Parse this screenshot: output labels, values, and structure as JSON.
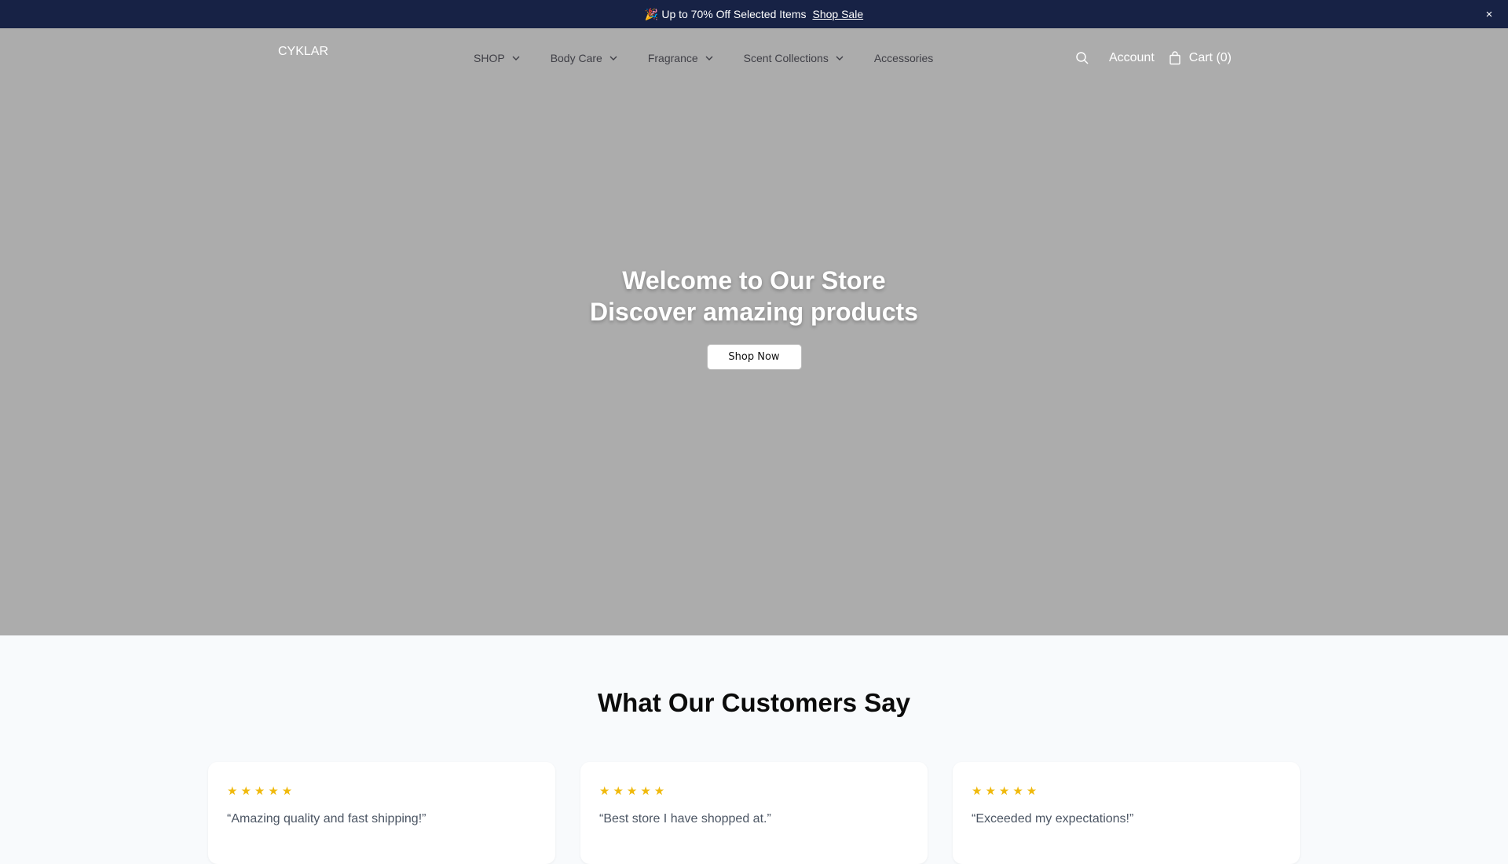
{
  "announcement": {
    "emoji": "🎉",
    "text": "Up to 70% Off Selected Items",
    "link": "Shop Sale",
    "close": "×"
  },
  "header": {
    "logo_alt": "CYKLAR",
    "nav": [
      {
        "label": "SHOP",
        "has_dropdown": true
      },
      {
        "label": "Body Care",
        "has_dropdown": true
      },
      {
        "label": "Fragrance",
        "has_dropdown": true
      },
      {
        "label": "Scent Collections",
        "has_dropdown": true
      },
      {
        "label": "Accessories",
        "has_dropdown": false
      }
    ],
    "account": "Account",
    "cart": "Cart (0)"
  },
  "hero": {
    "line1": "Welcome to Our Store",
    "line2": "Discover amazing products",
    "cta": "Shop Now"
  },
  "reviews": {
    "title": "What Our Customers Say",
    "items": [
      {
        "stars": "★★★★★",
        "quote": "“Amazing quality and fast shipping!”"
      },
      {
        "stars": "★★★★★",
        "quote": "“Best store I have shopped at.”"
      },
      {
        "stars": "★★★★★",
        "quote": "“Exceeded my expectations!”"
      }
    ]
  },
  "colors": {
    "announcement_bg": "#172245",
    "hero_bg": "#acacac",
    "star": "#f0b90b",
    "page_bg": "#f8fafc"
  }
}
